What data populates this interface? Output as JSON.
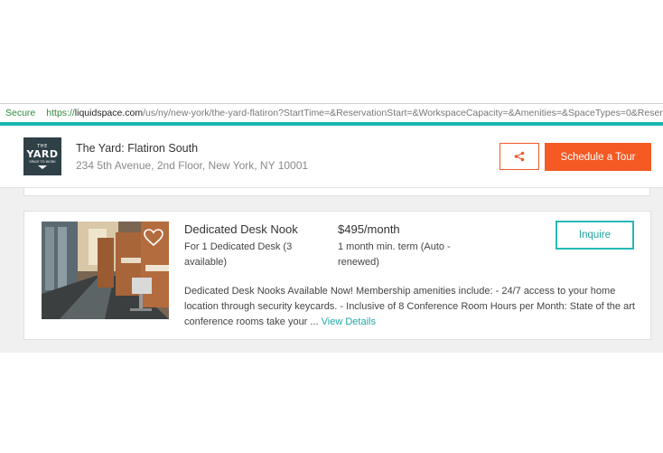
{
  "browser": {
    "secure_label": "Secure",
    "url_scheme": "https://",
    "url_host": "liquidspace.com",
    "url_rest": "/us/ny/new-york/the-yard-flatiron?StartTime=&ReservationStart=&WorkspaceCapacity=&Amenities=&SpaceTypes=0&Reservatio"
  },
  "header": {
    "logo": {
      "the": "THE",
      "yard": "YARD",
      "sub": "SPACE TO WORK"
    },
    "title": "The Yard: Flatiron South",
    "address": "234 5th Avenue, 2nd Floor, New York, NY 10001",
    "share_icon": "share-icon",
    "schedule_tour_label": "Schedule a Tour"
  },
  "listing": {
    "title": "Dedicated Desk Nook",
    "subtitle": "For 1 Dedicated Desk (3 available)",
    "price": "$495/month",
    "term": "1 month min. term (Auto - renewed)",
    "inquire_label": "Inquire",
    "description": "Dedicated Desk Nooks Available Now! Membership amenities include: - 24/7 access to your home location through security keycards. - Inclusive of 8 Conference Room Hours per Month: State of the art conference rooms take your ...",
    "view_details_label": "View Details",
    "favorite_icon": "heart-icon"
  },
  "colors": {
    "accent_teal": "#19b6b0",
    "accent_orange": "#f55a24",
    "secure_green": "#2e8b3a"
  }
}
